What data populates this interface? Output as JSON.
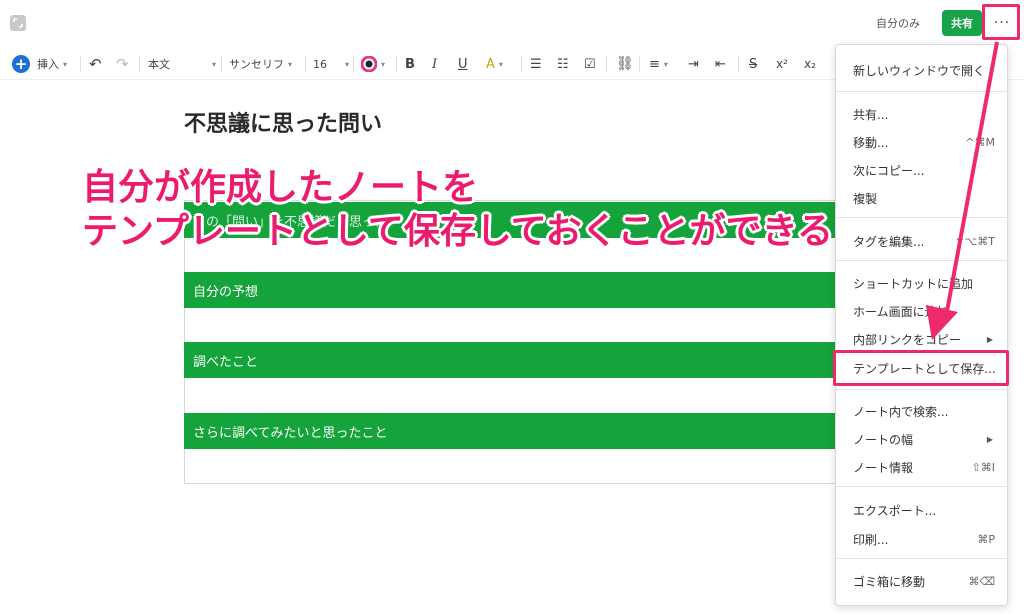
{
  "header": {
    "visibility": "自分のみ",
    "share_label": "共有",
    "more_label": "···"
  },
  "toolbar": {
    "insert_label": "挿入",
    "text_style": "本文",
    "font_family": "サンセリフ",
    "font_size": "16",
    "superscript": "x²",
    "subscript": "x₂"
  },
  "note": {
    "title": "不思議に思った問い",
    "rows": [
      "この「問い」を不思議だと思った",
      "自分の予想",
      "調べたこと",
      "さらに調べてみたいと思ったこと"
    ]
  },
  "annotation": {
    "line1": "自分が作成したノートを",
    "line2": "テンプレートとして保存しておくことができる",
    "color": "#ec1b6e"
  },
  "menu": {
    "open_new_window": "新しいウィンドウで開く",
    "share": "共有...",
    "move": "移動...",
    "move_sc": "^⌘M",
    "copy_to": "次にコピー...",
    "duplicate": "複製",
    "edit_tags": "タグを編集...",
    "edit_tags_sc": "^⌥⌘T",
    "add_shortcut": "ショートカットに追加",
    "home_screen": "ホーム画面に追加",
    "copy_internal_link": "内部リンクをコピー",
    "save_as_template": "テンプレートとして保存...",
    "find_in_note": "ノート内で検索...",
    "note_width": "ノートの幅",
    "note_info": "ノート情報",
    "note_info_sc": "⇧⌘I",
    "export": "エクスポート...",
    "print": "印刷...",
    "print_sc": "⌘P",
    "move_to_trash": "ゴミ箱に移動",
    "move_to_trash_sc": "⌘⌫"
  },
  "colors": {
    "accent_green": "#15a33b",
    "highlight_pink": "#ee2a6a",
    "insert_blue": "#1f6fd6"
  }
}
